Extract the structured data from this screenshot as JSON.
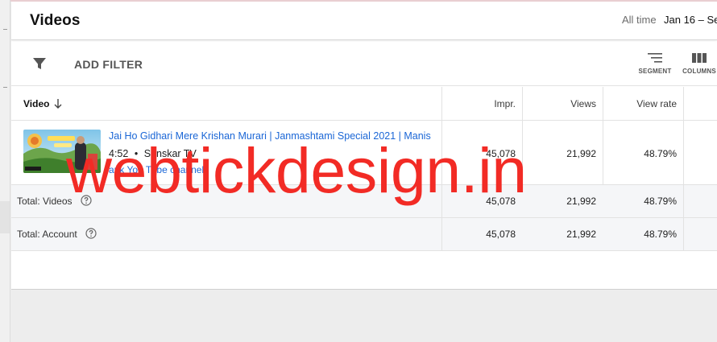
{
  "header": {
    "title": "Videos",
    "range_label": "All time",
    "range_value": "Jan 16 – Se"
  },
  "toolbar": {
    "add_filter_label": "ADD FILTER",
    "segment_label": "SEGMENT",
    "columns_label": "COLUMNS",
    "icons": {
      "filter": "filter-funnel-icon",
      "segment": "segment-lines-icon",
      "columns": "columns-grid-icon"
    }
  },
  "table": {
    "video_header": "Video",
    "sort_icon": "arrow-down-icon",
    "columns": [
      "Impr.",
      "Views",
      "View rate"
    ],
    "video_row": {
      "title": "Jai Ho Gidhari Mere Krishan Murari | Janmashtami Special 2021 | Manis",
      "duration": "4:52",
      "separator": "•",
      "channel": "Sanskar TV",
      "link_text": "ank You Tube channel",
      "impr": "45,078",
      "views": "21,992",
      "view_rate": "48.79%"
    },
    "totals": [
      {
        "label": "Total: Videos",
        "impr": "45,078",
        "views": "21,992",
        "view_rate": "48.79%"
      },
      {
        "label": "Total: Account",
        "impr": "45,078",
        "views": "21,992",
        "view_rate": "48.79%"
      }
    ],
    "help_icon": "help-circle-icon"
  },
  "watermark": {
    "text": "webtickdesign.in",
    "color": "#f22b25"
  },
  "colors": {
    "link": "#1a66d6",
    "total_row_bg": "#f5f6f8"
  }
}
